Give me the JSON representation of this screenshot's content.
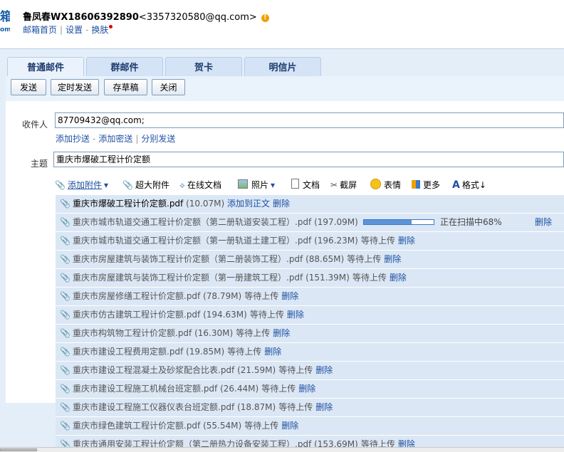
{
  "header": {
    "logo_fragment_big": "箱",
    "logo_fragment_small": "om",
    "user_name": "鲁凤春WX18606392890",
    "user_email": "<3357320580@qq.com>",
    "warning_glyph": "!",
    "links": [
      "邮箱首页",
      "设置",
      "换肤"
    ],
    "link_sep": "|",
    "link_sep2": "-"
  },
  "tabs": [
    "普通邮件",
    "群邮件",
    "贺卡",
    "明信片"
  ],
  "toolbar": {
    "send": "发送",
    "scheduled_send": "定时发送",
    "save_draft": "存草稿",
    "close": "关闭"
  },
  "compose": {
    "recipient_label": "收件人",
    "recipient_value": "87709432@qq.com;",
    "add_cc": "添加抄送",
    "add_bcc": "添加密送",
    "separate_send": "分别发送",
    "dash": "-",
    "bar": "|",
    "subject_label": "主题",
    "subject_value": "重庆市爆破工程计价定额"
  },
  "attach_toolbar": {
    "add_attachment": "添加附件",
    "large_attachment": "超大附件",
    "online_docs": "在线文档",
    "photos": "照片",
    "docs": "文档",
    "screenshot": "截屏",
    "emoji": "表情",
    "more": "更多",
    "format": "格式↓",
    "dropdown_glyph": "▾"
  },
  "attachments": [
    {
      "name": "重庆市爆破工程计价定额.pdf",
      "size": "(10.07M)",
      "status": "添加到正文",
      "action": "删除"
    },
    {
      "name": "重庆市城市轨道交通工程计价定额（第二册轨道安装工程）.pdf",
      "size": "(197.09M)",
      "status": "正在扫描中68%",
      "progress": 0.68,
      "action": "删除"
    },
    {
      "name": "重庆市城市轨道交通工程计价定额（第一册轨道土建工程）.pdf",
      "size": "(196.23M)",
      "status": "等待上传",
      "action": "删除"
    },
    {
      "name": "重庆市房屋建筑与装饰工程计价定额（第二册装饰工程）.pdf",
      "size": "(88.65M)",
      "status": "等待上传",
      "action": "删除"
    },
    {
      "name": "重庆市房屋建筑与装饰工程计价定额（第一册建筑工程）.pdf",
      "size": "(151.39M)",
      "status": "等待上传",
      "action": "删除"
    },
    {
      "name": "重庆市房屋修缮工程计价定额.pdf",
      "size": "(78.79M)",
      "status": "等待上传",
      "action": "删除"
    },
    {
      "name": "重庆市仿古建筑工程计价定额.pdf",
      "size": "(194.63M)",
      "status": "等待上传",
      "action": "删除"
    },
    {
      "name": "重庆市构筑物工程计价定额.pdf",
      "size": "(16.30M)",
      "status": "等待上传",
      "action": "删除"
    },
    {
      "name": "重庆市建设工程费用定额.pdf",
      "size": "(19.85M)",
      "status": "等待上传",
      "action": "删除"
    },
    {
      "name": "重庆市建设工程混凝土及砂浆配合比表.pdf",
      "size": "(21.59M)",
      "status": "等待上传",
      "action": "删除"
    },
    {
      "name": "重庆市建设工程施工机械台班定额.pdf",
      "size": "(26.44M)",
      "status": "等待上传",
      "action": "删除"
    },
    {
      "name": "重庆市建设工程施工仪器仪表台班定额.pdf",
      "size": "(18.87M)",
      "status": "等待上传",
      "action": "删除"
    },
    {
      "name": "重庆市绿色建筑工程计价定额.pdf",
      "size": "(55.54M)",
      "status": "等待上传",
      "action": "删除"
    },
    {
      "name": "重庆市通用安装工程计价定额（第二册热力设备安装工程）.pdf",
      "size": "(153.69M)",
      "status": "等待上传",
      "action": "删除"
    }
  ],
  "colors": {
    "link": "#1e50a2",
    "panel_bg": "#e4eef9",
    "row_bg": "#dbe7f5",
    "warning": "#f0a000"
  }
}
